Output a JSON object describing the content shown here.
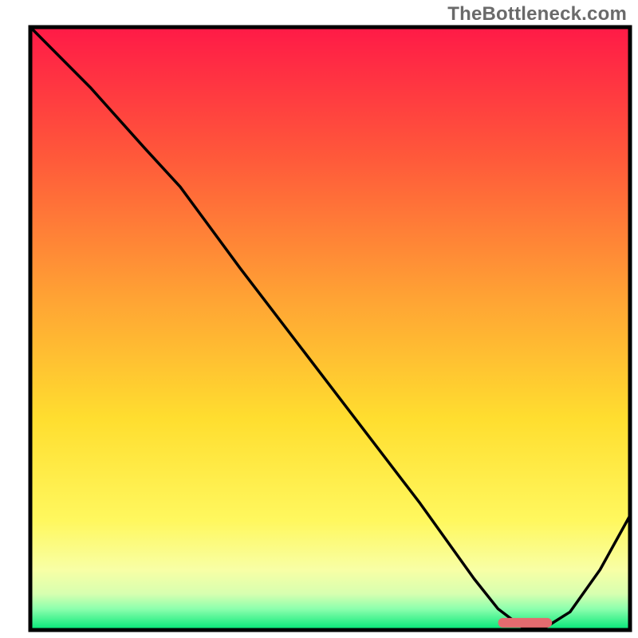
{
  "watermark": "TheBottleneck.com",
  "colors": {
    "frame": "#000000",
    "curve": "#000000",
    "marker_fill": "#e46b6f",
    "gradient_stops": [
      {
        "offset": 0.0,
        "color": "#ff1a47"
      },
      {
        "offset": 0.22,
        "color": "#ff5a3a"
      },
      {
        "offset": 0.45,
        "color": "#ffa334"
      },
      {
        "offset": 0.65,
        "color": "#ffde2f"
      },
      {
        "offset": 0.82,
        "color": "#fff85f"
      },
      {
        "offset": 0.9,
        "color": "#f8ffa5"
      },
      {
        "offset": 0.94,
        "color": "#d7ffb0"
      },
      {
        "offset": 0.965,
        "color": "#8cffad"
      },
      {
        "offset": 1.0,
        "color": "#00e676"
      }
    ]
  },
  "chart_data": {
    "type": "line",
    "title": "",
    "xlabel": "",
    "ylabel": "",
    "x": [
      0.0,
      0.1,
      0.19,
      0.25,
      0.35,
      0.45,
      0.55,
      0.65,
      0.74,
      0.78,
      0.82,
      0.86,
      0.9,
      0.95,
      1.0
    ],
    "values": [
      1.0,
      0.9,
      0.8,
      0.735,
      0.6,
      0.47,
      0.34,
      0.21,
      0.085,
      0.035,
      0.005,
      0.005,
      0.03,
      0.1,
      0.19
    ],
    "xlim": [
      0,
      1
    ],
    "ylim": [
      0,
      1
    ],
    "marker_range_x": [
      0.78,
      0.87
    ],
    "marker_y": 0.012
  }
}
